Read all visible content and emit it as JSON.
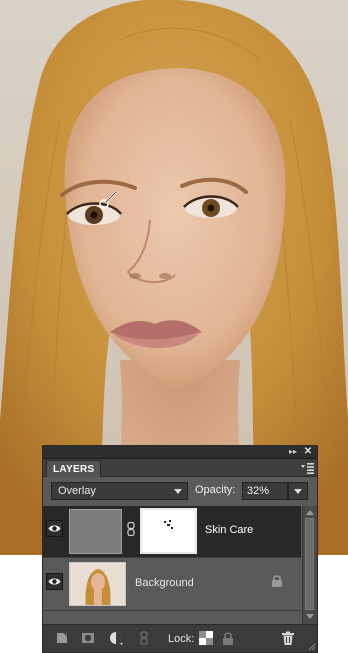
{
  "canvas": {
    "image": "portrait-photo",
    "cursor": "brush-cursor-icon"
  },
  "panel": {
    "tab_label": "LAYERS",
    "blend_mode": "Overlay",
    "opacity_label": "Opacity:",
    "opacity_value": "32%",
    "lock_label": "Lock:",
    "icons": {
      "collapse": "double-chevron-right-icon",
      "close": "close-icon",
      "menu": "panel-menu-icon"
    }
  },
  "layers": [
    {
      "name": "Skin Care",
      "visible": true,
      "selected": true,
      "has_mask": true,
      "locked": false
    },
    {
      "name": "Background",
      "visible": true,
      "selected": false,
      "has_mask": false,
      "locked": true
    }
  ],
  "footer_buttons": [
    "new-layer-icon",
    "add-mask-icon",
    "adjustment-layer-icon",
    "link-layers-icon",
    "lock-transparency-icon",
    "lock-all-icon",
    "trash-icon"
  ],
  "colors": {
    "panel_bg": "#5a5a5a",
    "selected_row": "#282828",
    "hair": "#c58f3a"
  }
}
